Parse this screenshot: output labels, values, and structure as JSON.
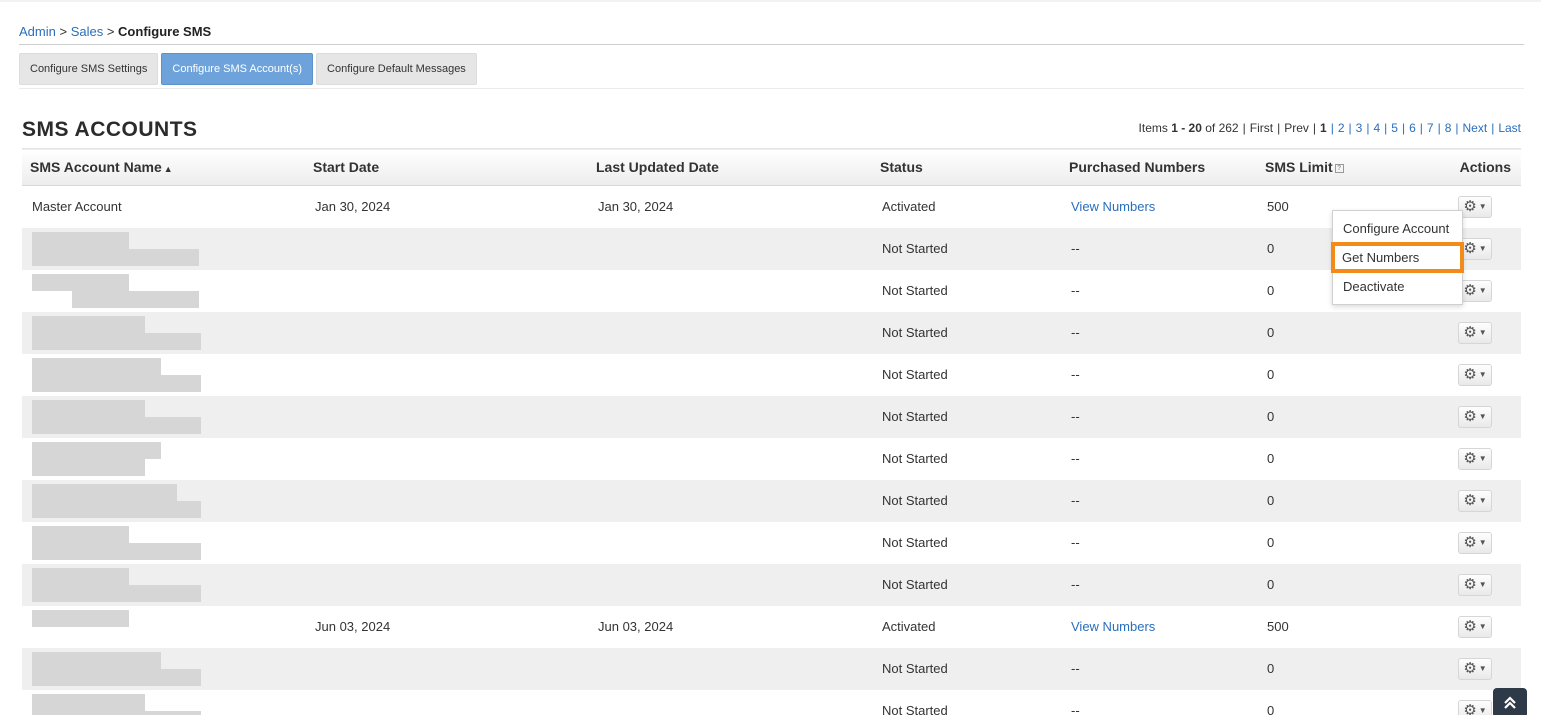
{
  "breadcrumb": {
    "admin": "Admin",
    "sep1": " > ",
    "sales": "Sales",
    "sep2": " > ",
    "current": "Configure SMS"
  },
  "tabs": [
    {
      "label": "Configure SMS Settings",
      "active": false
    },
    {
      "label": "Configure SMS Account(s)",
      "active": true
    },
    {
      "label": "Configure Default Messages",
      "active": false
    }
  ],
  "page_title": "SMS ACCOUNTS",
  "pager": {
    "items_prefix": "Items ",
    "range": "1 - 20",
    "of_text": " of 262",
    "first": "First",
    "prev": "Prev",
    "current": "1",
    "pages": [
      "2",
      "3",
      "4",
      "5",
      "6",
      "7",
      "8"
    ],
    "next": "Next",
    "last": "Last"
  },
  "table": {
    "headers": {
      "name": "SMS Account Name",
      "start": "Start Date",
      "updated": "Last Updated Date",
      "status": "Status",
      "numbers": "Purchased Numbers",
      "limit": "SMS Limit",
      "actions": "Actions"
    },
    "help_glyph": "?",
    "sort_glyph": "▲",
    "rows": [
      {
        "name": "Master Account",
        "start": "Jan 30, 2024",
        "updated": "Jan 30, 2024",
        "status": "Activated",
        "numbers": "View Numbers",
        "limit": "500"
      },
      {
        "name": "",
        "start": "",
        "updated": "",
        "status": "Not Started",
        "numbers": "--",
        "limit": "0"
      },
      {
        "name": "",
        "start": "",
        "updated": "",
        "status": "Not Started",
        "numbers": "--",
        "limit": "0"
      },
      {
        "name": "",
        "start": "",
        "updated": "",
        "status": "Not Started",
        "numbers": "--",
        "limit": "0"
      },
      {
        "name": "",
        "start": "",
        "updated": "",
        "status": "Not Started",
        "numbers": "--",
        "limit": "0"
      },
      {
        "name": "",
        "start": "",
        "updated": "",
        "status": "Not Started",
        "numbers": "--",
        "limit": "0"
      },
      {
        "name": "",
        "start": "",
        "updated": "",
        "status": "Not Started",
        "numbers": "--",
        "limit": "0"
      },
      {
        "name": "",
        "start": "",
        "updated": "",
        "status": "Not Started",
        "numbers": "--",
        "limit": "0"
      },
      {
        "name": "",
        "start": "",
        "updated": "",
        "status": "Not Started",
        "numbers": "--",
        "limit": "0"
      },
      {
        "name": "",
        "start": "",
        "updated": "",
        "status": "Not Started",
        "numbers": "--",
        "limit": "0"
      },
      {
        "name": "",
        "start": "Jun 03, 2024",
        "updated": "Jun 03, 2024",
        "status": "Activated",
        "numbers": "View Numbers",
        "limit": "500"
      },
      {
        "name": "",
        "start": "",
        "updated": "",
        "status": "Not Started",
        "numbers": "--",
        "limit": "0"
      },
      {
        "name": "",
        "start": "",
        "updated": "",
        "status": "Not Started",
        "numbers": "--",
        "limit": "0"
      }
    ]
  },
  "action_menu": {
    "items": [
      {
        "label": "Configure Account",
        "highlighted": false
      },
      {
        "label": "Get Numbers",
        "highlighted": true
      },
      {
        "label": "Deactivate",
        "highlighted": false
      }
    ]
  },
  "icons": {
    "gear": "gear-icon",
    "caret": "caret-down-icon",
    "scroll_top": "double-chevron-up-icon"
  },
  "colors": {
    "link": "#2a6ebb",
    "active_tab": "#6da3da",
    "highlight": "#f28b1a",
    "scroll_button": "#2e3a48"
  }
}
